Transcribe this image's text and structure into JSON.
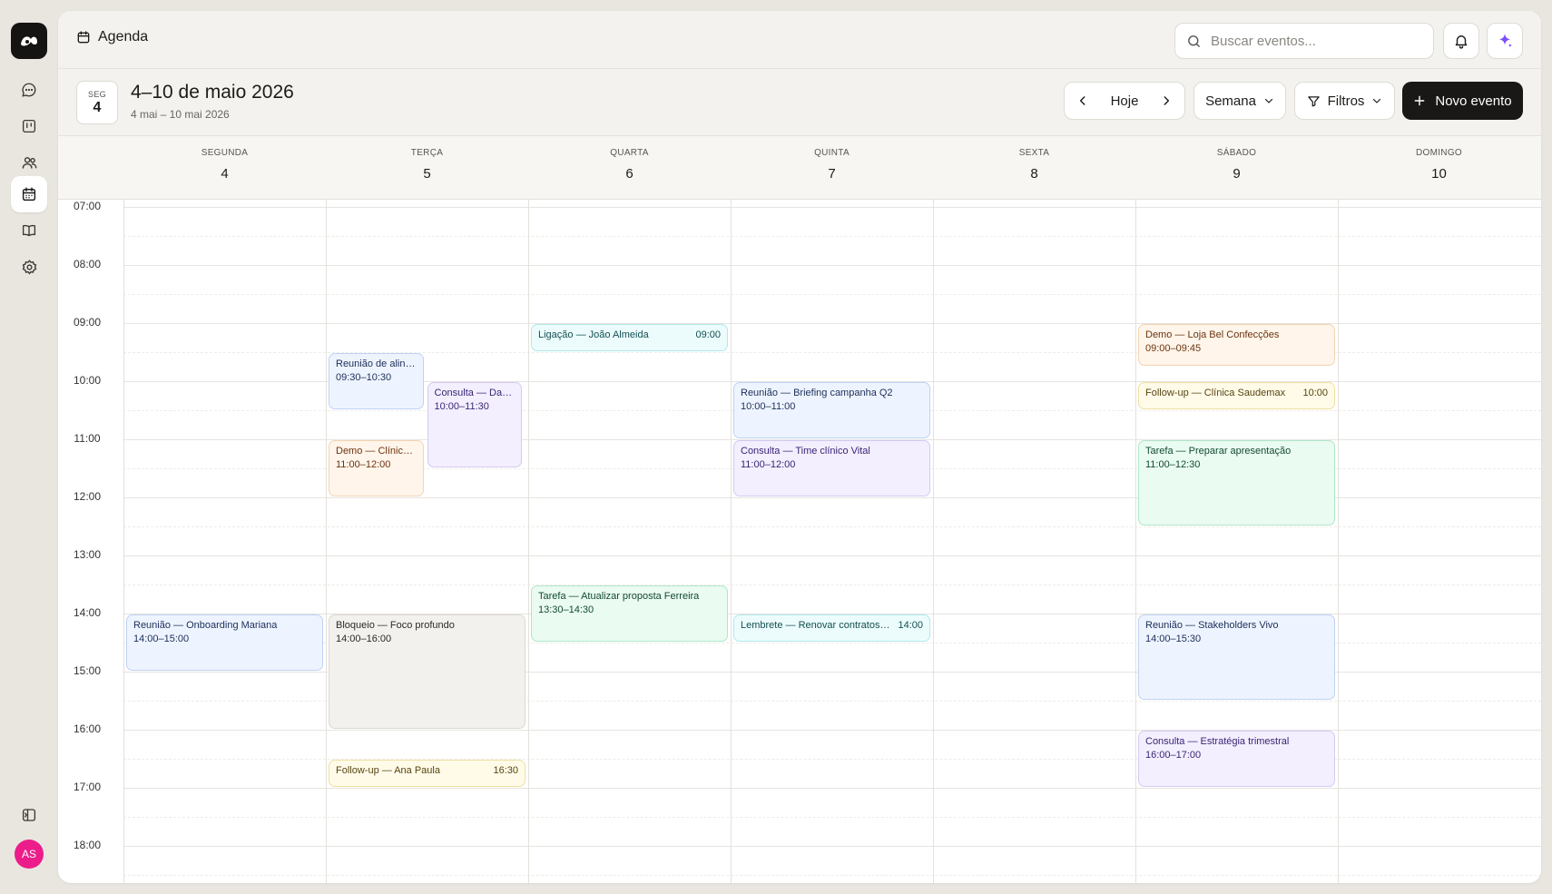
{
  "app": {
    "title": "Agenda"
  },
  "rail": {
    "icons": [
      "chat-icon",
      "board-icon",
      "users-icon",
      "calendar-icon",
      "book-icon",
      "settings-icon"
    ],
    "bottom_icons": [
      "panel-toggle-icon"
    ],
    "avatar_initials": "AS",
    "avatar_color": "#ec1d8a"
  },
  "header": {
    "search_placeholder": "Buscar eventos...",
    "accent_color": "#7c4dff"
  },
  "toolbar": {
    "today_badge_dow": "SEG",
    "today_badge_num": "4",
    "range_title": "4–10 de maio 2026",
    "range_subtitle": "4 mai – 10 mai 2026",
    "today_label": "Hoje",
    "view_label": "Semana",
    "filters_label": "Filtros",
    "new_event_label": "Novo evento"
  },
  "days": [
    {
      "name": "SEGUNDA",
      "num": "4"
    },
    {
      "name": "TERÇA",
      "num": "5"
    },
    {
      "name": "QUARTA",
      "num": "6"
    },
    {
      "name": "QUINTA",
      "num": "7"
    },
    {
      "name": "SEXTA",
      "num": "8"
    },
    {
      "name": "SÁBADO",
      "num": "9"
    },
    {
      "name": "DOMINGO",
      "num": "10"
    }
  ],
  "hours": [
    "07:00",
    "08:00",
    "09:00",
    "10:00",
    "11:00",
    "12:00",
    "13:00",
    "14:00",
    "15:00",
    "16:00",
    "17:00",
    "18:00"
  ],
  "events": [
    {
      "day": 0,
      "start": 14.0,
      "end": 15.0,
      "lane": 0,
      "lanes": 1,
      "title": "Reunião — Onboarding Mariana",
      "time": "14:00–15:00",
      "color": "blue"
    },
    {
      "day": 1,
      "start": 9.5,
      "end": 10.5,
      "lane": 0,
      "lanes": 2,
      "title": "Reunião de alinhamento",
      "time": "09:30–10:30",
      "color": "blue"
    },
    {
      "day": 1,
      "start": 10.0,
      "end": 11.5,
      "lane": 1,
      "lanes": 2,
      "title": "Consulta — Davi Rocha",
      "time": "10:00–11:30",
      "color": "purple"
    },
    {
      "day": 1,
      "start": 11.0,
      "end": 12.0,
      "lane": 0,
      "lanes": 2,
      "title": "Demo — Clínica Saudemax",
      "time": "11:00–12:00",
      "color": "orange"
    },
    {
      "day": 1,
      "start": 14.0,
      "end": 16.0,
      "lane": 0,
      "lanes": 1,
      "title": "Bloqueio — Foco profundo",
      "time": "14:00–16:00",
      "color": "gray"
    },
    {
      "day": 1,
      "start": 16.5,
      "end": 17.0,
      "lane": 0,
      "lanes": 1,
      "title": "Follow-up — Ana Paula",
      "time": "16:30",
      "color": "yellow",
      "compact": true
    },
    {
      "day": 2,
      "start": 9.0,
      "end": 9.5,
      "lane": 0,
      "lanes": 1,
      "title": "Ligação — João Almeida",
      "time": "09:00",
      "color": "cyan",
      "compact": true
    },
    {
      "day": 2,
      "start": 13.5,
      "end": 14.5,
      "lane": 0,
      "lanes": 1,
      "title": "Tarefa — Atualizar proposta Ferreira",
      "time": "13:30–14:30",
      "color": "green"
    },
    {
      "day": 3,
      "start": 10.0,
      "end": 11.0,
      "lane": 0,
      "lanes": 1,
      "title": "Reunião — Briefing campanha Q2",
      "time": "10:00–11:00",
      "color": "blue"
    },
    {
      "day": 3,
      "start": 11.0,
      "end": 12.0,
      "lane": 0,
      "lanes": 1,
      "title": "Consulta — Time clínico Vital",
      "time": "11:00–12:00",
      "color": "purple"
    },
    {
      "day": 3,
      "start": 14.0,
      "end": 14.5,
      "lane": 0,
      "lanes": 1,
      "title": "Lembrete — Renovar contratos anuais",
      "time": "14:00",
      "color": "cyan",
      "compact": true
    },
    {
      "day": 5,
      "start": 9.0,
      "end": 9.75,
      "lane": 0,
      "lanes": 1,
      "title": "Demo — Loja Bel Confecções",
      "time": "09:00–09:45",
      "color": "orange"
    },
    {
      "day": 5,
      "start": 10.0,
      "end": 10.5,
      "lane": 0,
      "lanes": 1,
      "title": "Follow-up — Clínica Saudemax",
      "time": "10:00",
      "color": "yellow",
      "compact": true
    },
    {
      "day": 5,
      "start": 11.0,
      "end": 12.5,
      "lane": 0,
      "lanes": 1,
      "title": "Tarefa — Preparar apresentação",
      "time": "11:00–12:30",
      "color": "green"
    },
    {
      "day": 5,
      "start": 14.0,
      "end": 15.5,
      "lane": 0,
      "lanes": 1,
      "title": "Reunião — Stakeholders Vivo",
      "time": "14:00–15:30",
      "color": "blue"
    },
    {
      "day": 5,
      "start": 16.0,
      "end": 17.0,
      "lane": 0,
      "lanes": 1,
      "title": "Consulta — Estratégia trimestral",
      "time": "16:00–17:00",
      "color": "purple"
    }
  ]
}
